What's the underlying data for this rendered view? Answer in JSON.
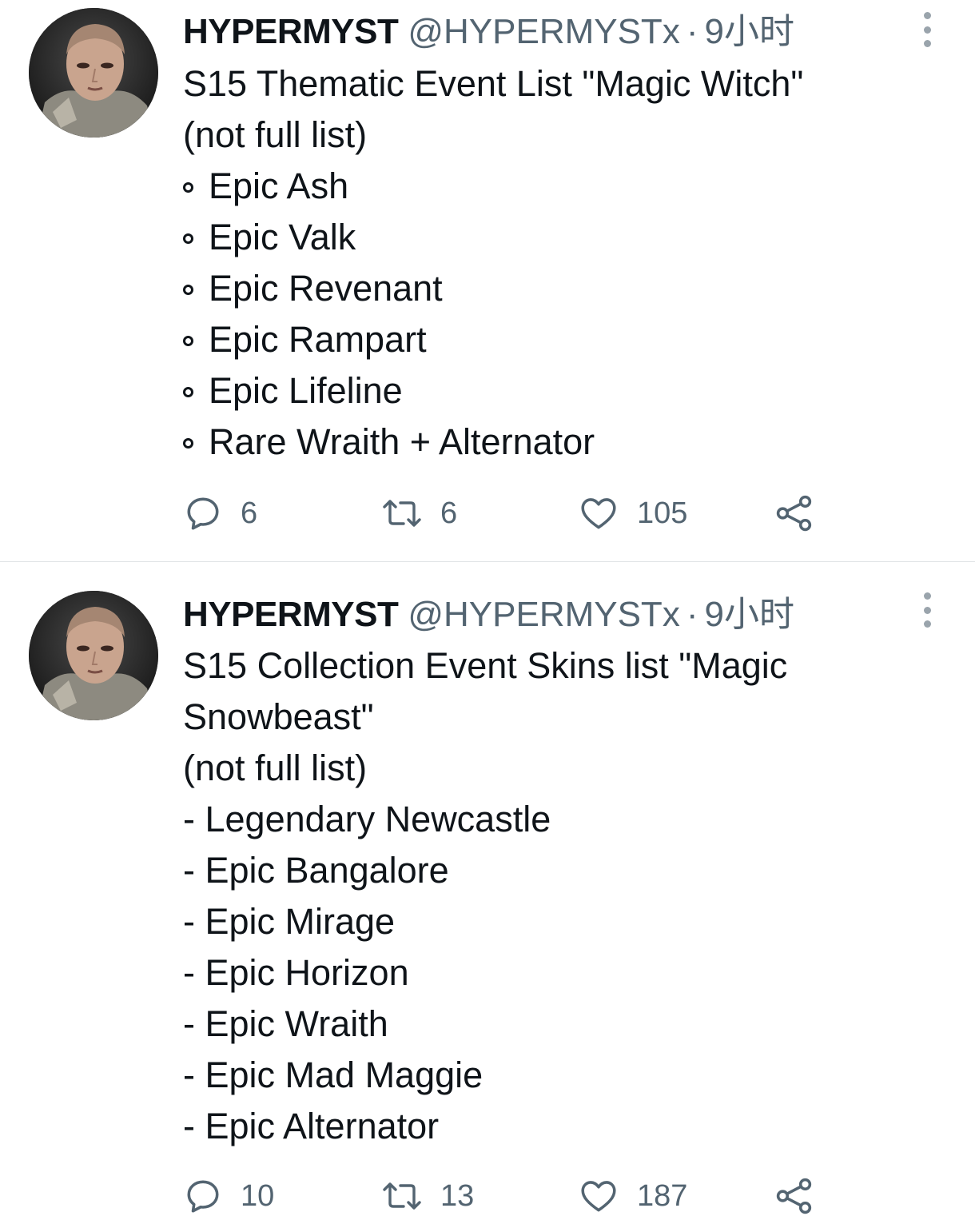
{
  "tweets": [
    {
      "author_name": "HYPERMYST",
      "handle": "@HYPERMYSTx",
      "separator": "·",
      "time": "9小时",
      "lines": [
        {
          "text": "S15 Thematic Event List \"Magic Witch\"",
          "bullet": false
        },
        {
          "text": "(not full list)",
          "bullet": false
        },
        {
          "text": "Epic Ash",
          "bullet": true
        },
        {
          "text": "Epic Valk",
          "bullet": true
        },
        {
          "text": "Epic Revenant",
          "bullet": true
        },
        {
          "text": "Epic Rampart",
          "bullet": true
        },
        {
          "text": "Epic Lifeline",
          "bullet": true
        },
        {
          "text": "Rare Wraith + Alternator",
          "bullet": true
        }
      ],
      "replies": "6",
      "retweets": "6",
      "likes": "105"
    },
    {
      "author_name": "HYPERMYST",
      "handle": "@HYPERMYSTx",
      "separator": "·",
      "time": "9小时",
      "lines": [
        {
          "text": "S15 Collection Event Skins list \"Magic",
          "bullet": false
        },
        {
          "text": "Snowbeast\"",
          "bullet": false
        },
        {
          "text": "(not full list)",
          "bullet": false
        },
        {
          "text": "- Legendary Newcastle",
          "bullet": false
        },
        {
          "text": "- Epic Bangalore",
          "bullet": false
        },
        {
          "text": "- Epic Mirage",
          "bullet": false
        },
        {
          "text": "- Epic Horizon",
          "bullet": false
        },
        {
          "text": "- Epic Wraith",
          "bullet": false
        },
        {
          "text": "- Epic Mad Maggie",
          "bullet": false
        },
        {
          "text": "- Epic Alternator",
          "bullet": false
        }
      ],
      "replies": "10",
      "retweets": "13",
      "likes": "187"
    }
  ],
  "icons": {
    "reply": "reply-icon",
    "retweet": "retweet-icon",
    "like": "heart-icon",
    "share": "share-icon",
    "more": "more-vertical-icon"
  },
  "colors": {
    "text_primary": "#0f1419",
    "text_secondary": "#536471",
    "divider": "#e1e4e6"
  }
}
